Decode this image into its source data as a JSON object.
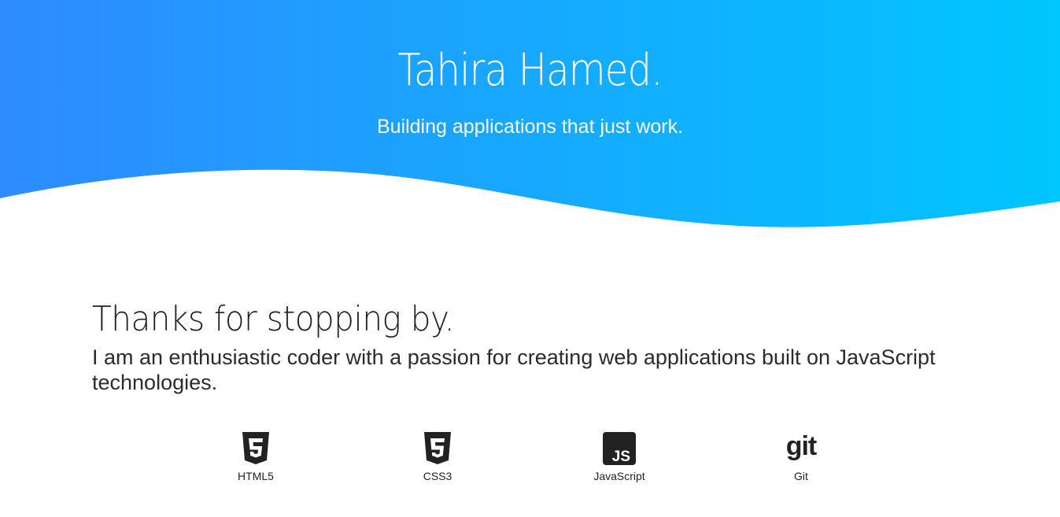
{
  "hero": {
    "title": "Tahira Hamed.",
    "subtitle": "Building applications that just work.",
    "gradient_start": "#2e8bff",
    "gradient_end": "#00c6ff"
  },
  "about": {
    "title": "Thanks for stopping by.",
    "text": "I am an enthusiastic coder with a passion for creating web applications built on JavaScript technologies."
  },
  "skills": [
    {
      "label": "HTML5",
      "icon": "html5-icon"
    },
    {
      "label": "CSS3",
      "icon": "css3-icon"
    },
    {
      "label": "JavaScript",
      "icon": "javascript-icon"
    },
    {
      "label": "Git",
      "icon": "git-icon"
    }
  ]
}
